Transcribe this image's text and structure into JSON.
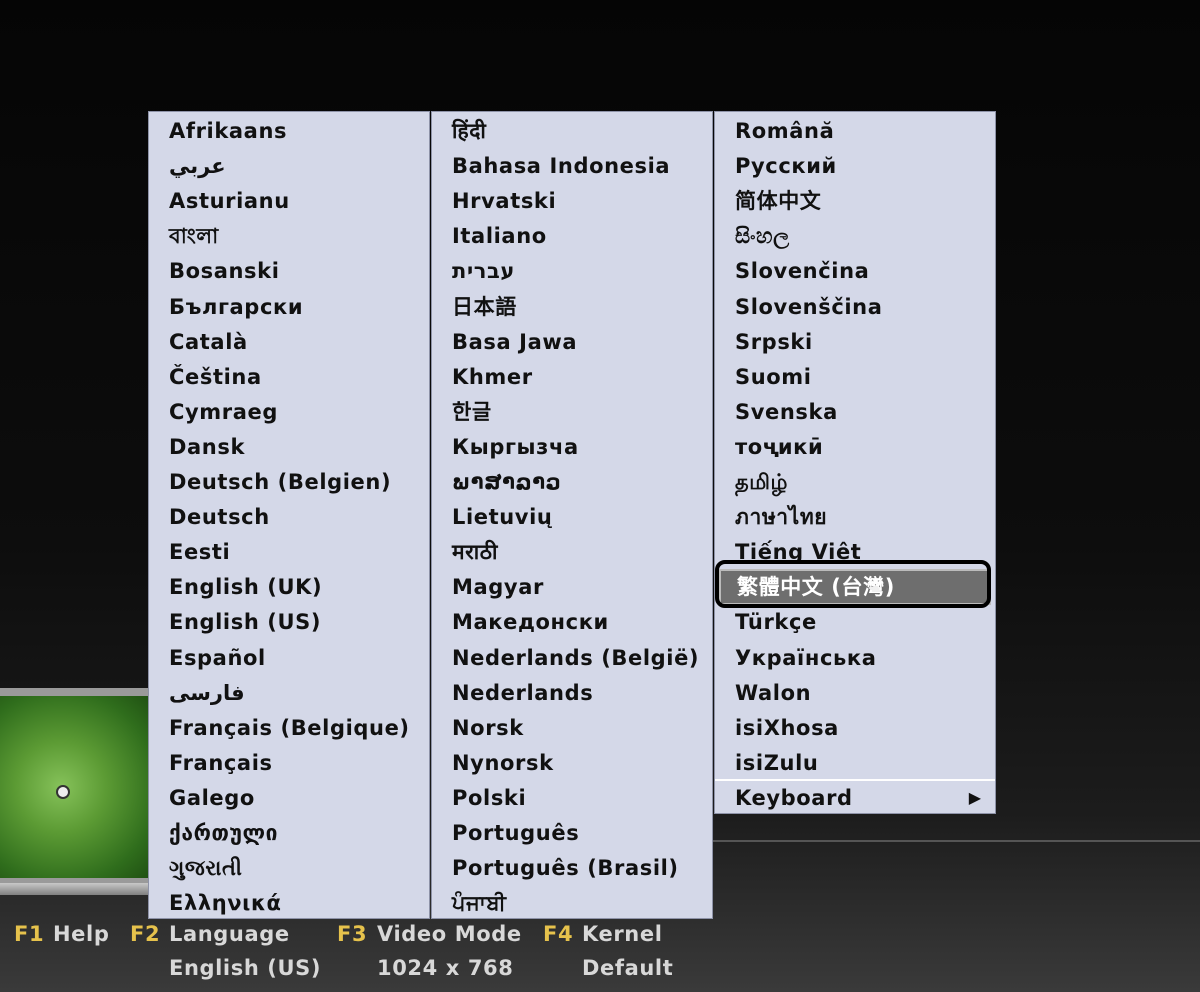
{
  "menu": {
    "column1": [
      "Afrikaans",
      "عربي",
      "Asturianu",
      "বাংলা",
      "Bosanski",
      "Български",
      "Català",
      "Čeština",
      "Cymraeg",
      "Dansk",
      "Deutsch (Belgien)",
      "Deutsch",
      "Eesti",
      "English (UK)",
      "English (US)",
      "Español",
      "فارسی",
      "Français (Belgique)",
      "Français",
      "Galego",
      "ქართული",
      "ગુજરાતી",
      "Ελληνικά"
    ],
    "column2": [
      "हिंदी",
      "Bahasa Indonesia",
      "Hrvatski",
      "Italiano",
      "עברית",
      "日本語",
      "Basa Jawa",
      "Khmer",
      "한글",
      "Кыргызча",
      "ພາສາລາວ",
      "Lietuvių",
      "मराठी",
      "Magyar",
      "Македонски",
      "Nederlands (België)",
      "Nederlands",
      "Norsk",
      "Nynorsk",
      "Polski",
      "Português",
      "Português (Brasil)",
      "ਪੰਜਾਬੀ"
    ],
    "column3": [
      "Română",
      "Русский",
      "简体中文",
      "සිංහල",
      "Slovenčina",
      "Slovenščina",
      "Srpski",
      "Suomi",
      "Svenska",
      "тоҷикӣ",
      "தமிழ்",
      "ภาษาไทย",
      "Tiếng Việt",
      "繁體中文 (台灣)",
      "Türkçe",
      "Українська",
      "Walon",
      "isiXhosa",
      "isiZulu"
    ],
    "selected": "繁體中文 (台灣)",
    "keyboard": {
      "label": "Keyboard",
      "arrow": "▶"
    }
  },
  "footer": {
    "f1": {
      "key": "F1",
      "label": "Help"
    },
    "f2": {
      "key": "F2",
      "label": "Language",
      "value": "English (US)"
    },
    "f3": {
      "key": "F3",
      "label": "Video Mode",
      "value": "1024 x 768"
    },
    "f4": {
      "key": "F4",
      "label": "Kernel",
      "value": "Default"
    }
  },
  "colors": {
    "menu_bg": "#d4d8e8",
    "selection_bg": "#6e6e6e",
    "fkey": "#e6c24c",
    "footer_text": "#d8d8d8"
  }
}
